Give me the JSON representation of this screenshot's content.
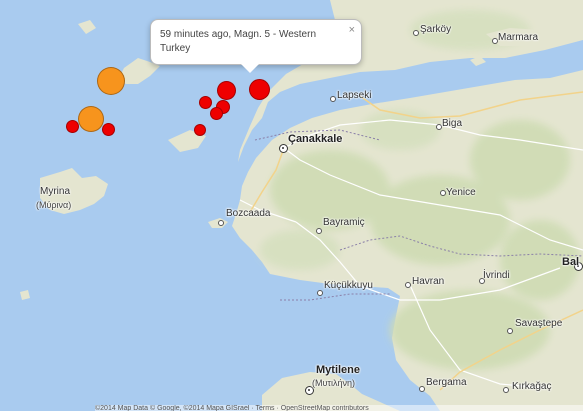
{
  "popup": {
    "text": "59 minutes ago, Magn. 5 - Western Turkey",
    "close_symbol": "×"
  },
  "places": {
    "sarkoy": "Şarköy",
    "marmara": "Marmara",
    "lapseki": "Lapseki",
    "canakkale": "Çanakkale",
    "biga": "Biga",
    "yenice": "Yenice",
    "myrina": "Myrina",
    "myrina_greek": "(Μύρινα)",
    "bozcaada": "Bozcaada",
    "bayramic": "Bayramiç",
    "balya": "Bal",
    "havran": "Havran",
    "ivrindi": "İvrindi",
    "kucukkuyu": "Küçükkuyu",
    "savastepe": "Savaştepe",
    "mytilene": "Mytilene",
    "mytilene_greek": "(Μυτιλήνη)",
    "bergama": "Bergama",
    "kirkagac": "Kırkağaç"
  },
  "earthquakes": [
    {
      "name": "orange",
      "color": "#f7941d"
    },
    {
      "name": "red",
      "color": "#ee0000"
    }
  ],
  "colors": {
    "sea": "#a9cbef",
    "land": "#e4e5d0",
    "forest": "#cfdcb4"
  },
  "attribution": "©2014 Map Data ©  Google, ©2014 Mapa GISrael · Terms · OpenStreetMap contributors"
}
